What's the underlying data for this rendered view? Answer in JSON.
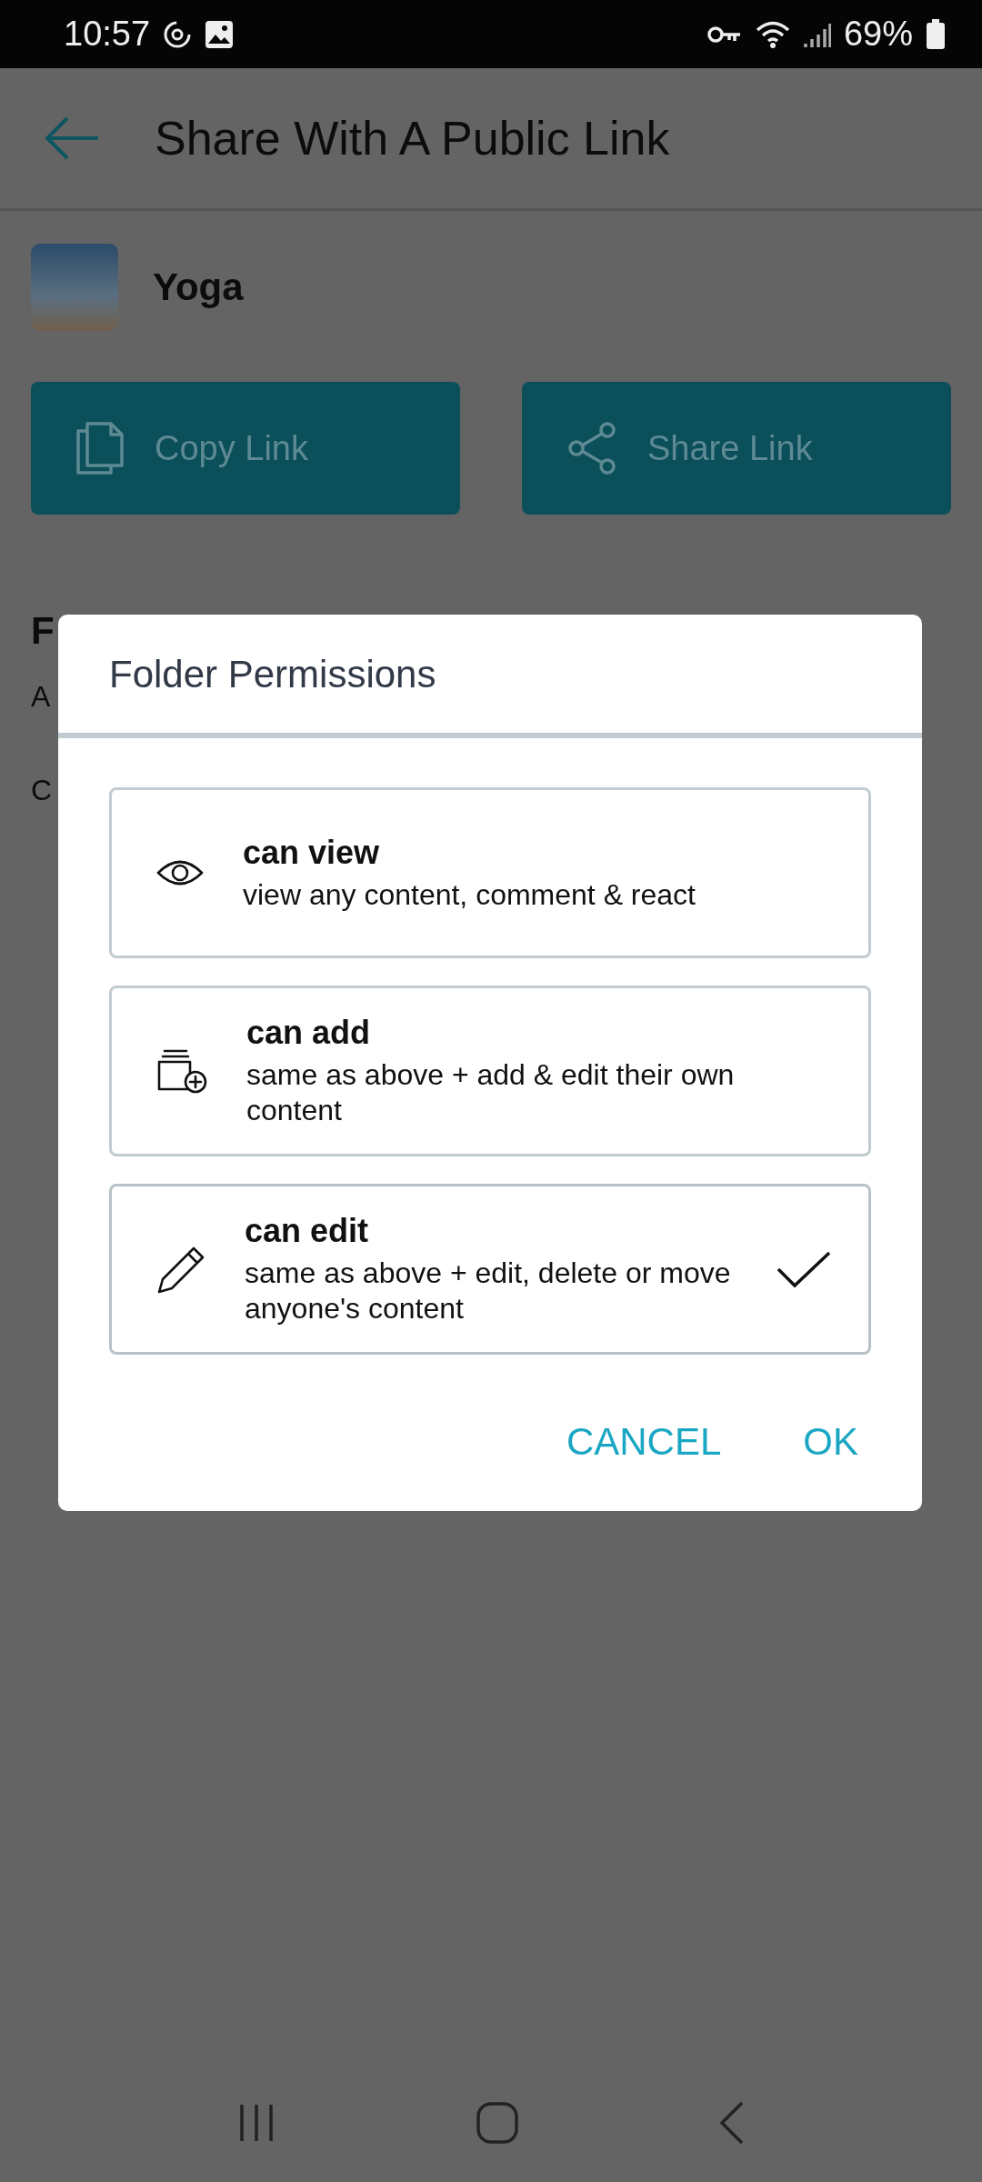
{
  "status_bar": {
    "time": "10:57",
    "battery": "69%"
  },
  "header": {
    "title": "Share With A Public Link"
  },
  "folder": {
    "name": "Yoga"
  },
  "actions": [
    {
      "label": "Copy Link"
    },
    {
      "label": "Share Link"
    }
  ],
  "section": {
    "heading": "F",
    "line_1": "A",
    "line_2": "C"
  },
  "dialog": {
    "title": "Folder Permissions",
    "options": [
      {
        "title": "can view",
        "description": "view any content, comment & react",
        "selected": false
      },
      {
        "title": "can add",
        "description": "same as above + add & edit their own content",
        "selected": false
      },
      {
        "title": "can edit",
        "description": "same as above + edit, delete or move anyone's content",
        "selected": true
      }
    ],
    "buttons": [
      "CANCEL",
      "OK"
    ]
  }
}
